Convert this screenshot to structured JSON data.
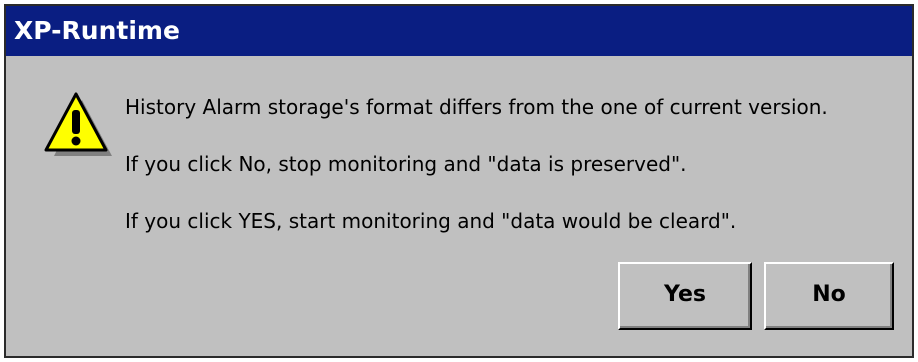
{
  "window": {
    "title": "XP-Runtime"
  },
  "dialog": {
    "icon": "warning-icon",
    "messages": [
      "History Alarm storage's format differs from the one of current version.",
      "If you click No, stop monitoring and \"data is preserved\".",
      "If you click YES, start monitoring and \"data would be cleard\"."
    ],
    "buttons": {
      "yes_label": "Yes",
      "no_label": "No"
    }
  },
  "colors": {
    "titlebar": "#0a1e82",
    "dialog_background": "#c0c0c0",
    "warning_fill": "#ffff00"
  }
}
